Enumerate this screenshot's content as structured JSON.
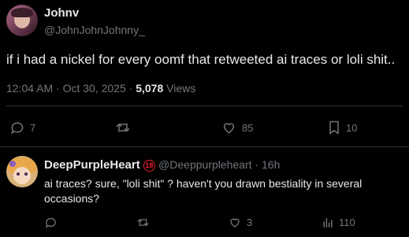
{
  "main_tweet": {
    "display_name": "Johnv",
    "handle": "@JohnJohnJohnny_",
    "text": "if i had a nickel for every oomf that retweeted ai traces or loli shit..",
    "time": "12:04 AM · Oct 30, 2025 · ",
    "views_count": "5,078",
    "views_label": " Views",
    "actions": {
      "replies": "7",
      "retweets": "",
      "likes": "85",
      "bookmarks": "10"
    }
  },
  "reply": {
    "display_name": "DeepPurpleHeart",
    "badge": "18",
    "handle_time": "@Deeppurpleheart · 16h",
    "text_line1": "ai traces? sure, \"loli shit\" ? haven't you drawn bestiality in several",
    "text_line2": "occasions?",
    "actions": {
      "replies": "",
      "retweets": "",
      "likes": "3",
      "views": "110"
    }
  },
  "colors": {
    "background": "#000000",
    "text": "#e7e9ea",
    "muted": "#71767b",
    "divider": "#2f3336",
    "badge_red": "#f4212e"
  }
}
